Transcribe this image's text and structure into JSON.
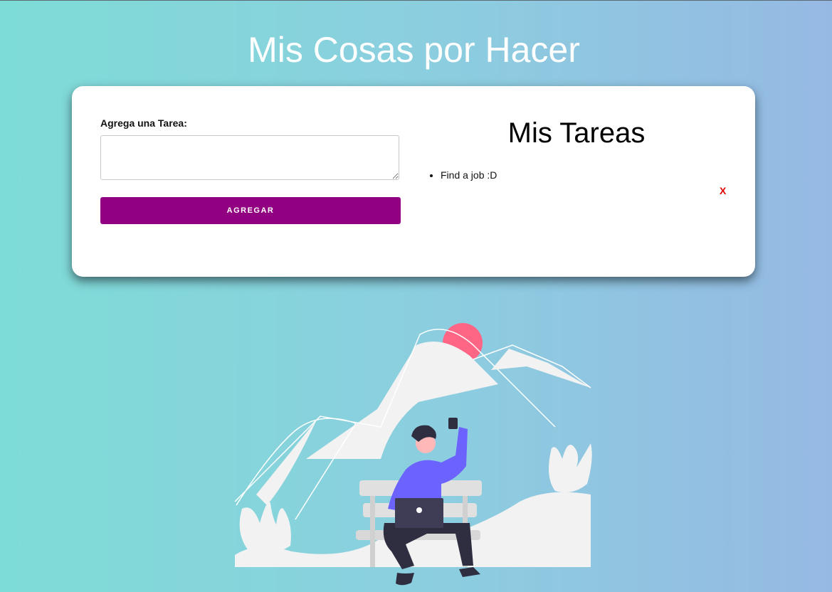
{
  "header": {
    "title": "Mis Cosas por Hacer"
  },
  "form": {
    "label": "Agrega una Tarea:",
    "input_value": "",
    "input_placeholder": "",
    "button_label": "AGREGAR"
  },
  "tasks": {
    "title": "Mis Tareas",
    "items": [
      {
        "text": "Find a job :D",
        "delete_label": "X"
      }
    ]
  },
  "colors": {
    "button": "#920082",
    "delete": "#e00000",
    "sun": "#ff6584",
    "shirt": "#6c63ff"
  },
  "illustration": {
    "icon": "person-on-bench-with-laptop-illustration"
  }
}
